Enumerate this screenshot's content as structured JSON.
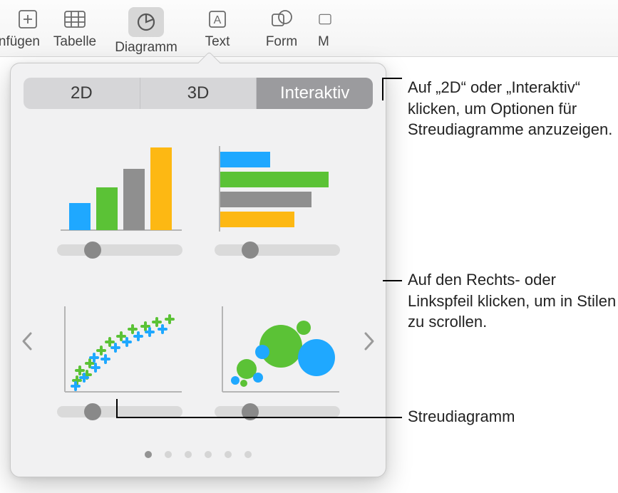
{
  "toolbar": {
    "items": [
      {
        "label": "nfügen",
        "icon": "insert"
      },
      {
        "label": "Tabelle",
        "icon": "table"
      },
      {
        "label": "Diagramm",
        "icon": "chart",
        "active": true
      },
      {
        "label": "Text",
        "icon": "text"
      },
      {
        "label": "Form",
        "icon": "shape"
      },
      {
        "label": "M",
        "icon": "media"
      }
    ]
  },
  "popover": {
    "segments": {
      "twoD": "2D",
      "threeD": "3D",
      "interactive": "Interaktiv"
    },
    "selected_segment": "interactive",
    "chart_types": [
      "column",
      "bar-horizontal",
      "scatter",
      "bubble"
    ],
    "page_dot_count": 6,
    "active_dot": 0
  },
  "callouts": {
    "seg_hint": "Auf „2D“ oder „Interaktiv“ klicken, um Optionen für Streudiagramme anzuzeigen.",
    "arrow_hint": "Auf den Rechts- oder Linkspfeil klicken, um in Stilen zu scrollen.",
    "scatter_label": "Streudiagramm"
  },
  "colors": {
    "blue": "#1fa8ff",
    "green": "#5bc236",
    "yellow": "#fdb813",
    "gray": "#8f8f8f"
  }
}
